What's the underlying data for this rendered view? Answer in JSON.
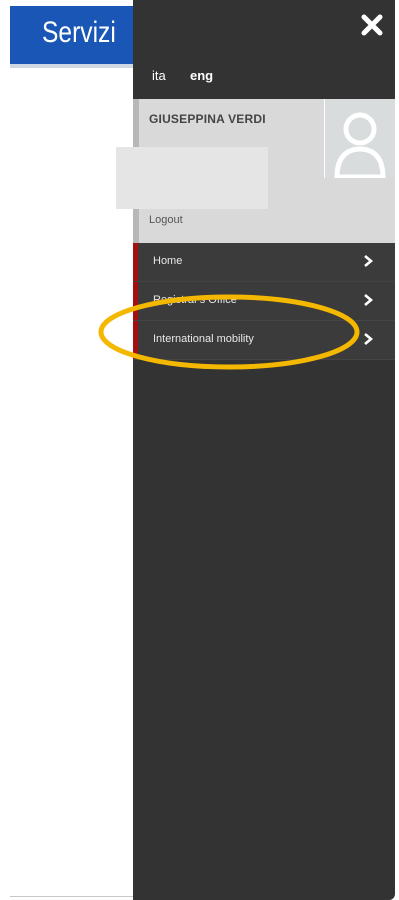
{
  "page": {
    "header_title": "Servizi"
  },
  "panel": {
    "languages": [
      {
        "label": "ita",
        "active": false
      },
      {
        "label": "eng",
        "active": true
      }
    ],
    "user": {
      "name": "GIUSEPPINA VERDI",
      "logout_label": "Logout"
    },
    "menu": [
      {
        "label": "Home"
      },
      {
        "label": "Registrar's Office"
      },
      {
        "label": "International mobility"
      }
    ]
  },
  "colors": {
    "header_blue": "#1a56b5",
    "panel_dark": "#333333",
    "accent_red": "#a60f0f",
    "annotation_yellow": "#f5b800"
  },
  "icons": {
    "close": "close-icon",
    "avatar": "user-avatar-icon",
    "chevron": "chevron-right-icon"
  }
}
